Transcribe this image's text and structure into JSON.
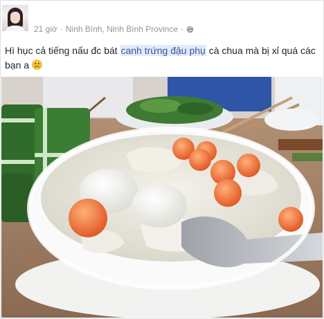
{
  "post": {
    "time": "21 giờ",
    "separator": "·",
    "location": "Ninh Bình, Ninh Bình Province",
    "separator_2": "·",
    "privacy_icon": "globe-icon",
    "caption_before": "Hì hục cả tiếng nấu đc bát ",
    "caption_highlight": "canh trứng đậu phụ",
    "caption_after": " cà chua mà bị xỉ quá các bạn a",
    "emoji": "sad-face-icon",
    "highlight_color": "#e1ebf9",
    "highlight_text_color": "#365899",
    "meta_color": "#90949c"
  },
  "photo": {
    "subject": "bowl-of-egg-tofu-tomato-soup"
  }
}
